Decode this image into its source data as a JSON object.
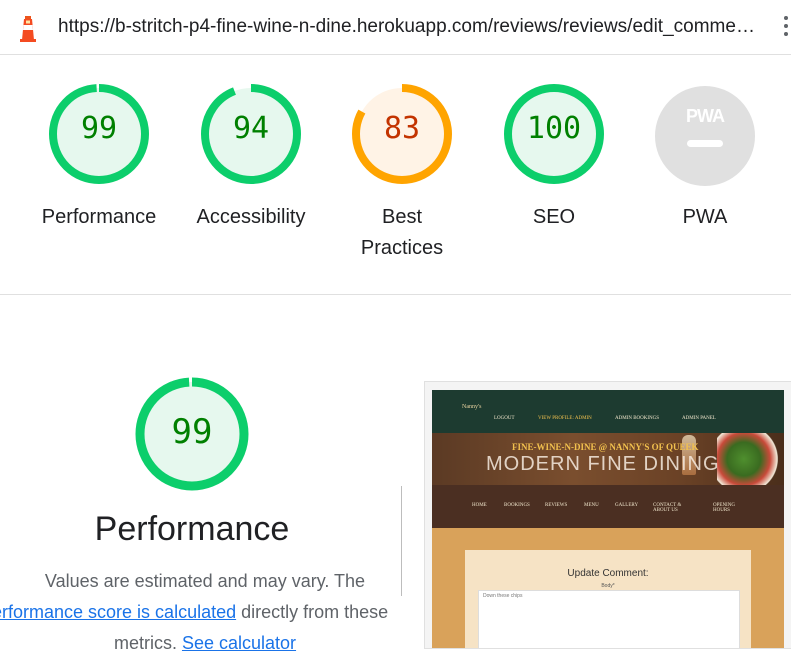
{
  "url": "https://b-stritch-p4-fine-wine-n-dine.herokuapp.com/reviews/reviews/edit_commen…",
  "categories": [
    {
      "label": "Performance",
      "score": "99",
      "fraction": 0.99,
      "color": "#0cce6b",
      "text_color": "#008000",
      "bg": "#e6f8ee"
    },
    {
      "label": "Accessibility",
      "score": "94",
      "fraction": 0.94,
      "color": "#0cce6b",
      "text_color": "#008000",
      "bg": "#e6f8ee"
    },
    {
      "label": "Best Practices",
      "score": "83",
      "fraction": 0.83,
      "color": "#ffa400",
      "text_color": "#c33300",
      "bg": "#fff3e6"
    },
    {
      "label": "SEO",
      "score": "100",
      "fraction": 1.0,
      "color": "#0cce6b",
      "text_color": "#008000",
      "bg": "#e6f8ee"
    },
    {
      "label": "PWA",
      "badge_text": "PWA"
    }
  ],
  "performance": {
    "score": "99",
    "fraction": 0.99,
    "title": "Performance",
    "desc_line1": "Values are estimated and may vary. The",
    "desc_link1": "erformance score is calculated",
    "desc_after_link1": " directly from these",
    "desc_line3_prefix": "metrics. ",
    "desc_link2": "See calculator"
  },
  "site_preview": {
    "logo": "Nanny's",
    "nav": [
      "LOGOUT",
      "VIEW PROFILE: ADMIN",
      "ADMIN BOOKINGS",
      "ADMIN PANEL"
    ],
    "hero_top": "FINE-WINE-N-DINE @ NANNY'S OF QUEEK",
    "hero_main": "MODERN FINE DINING",
    "subnav": [
      "HOME",
      "BOOKINGS",
      "REVIEWS",
      "MENU",
      "GALLERY",
      "CONTACT & ABOUT US",
      "OPENING HOURS"
    ],
    "card_title": "Update Comment:",
    "body_label": "Body*",
    "textarea_value": "Down these chips"
  }
}
